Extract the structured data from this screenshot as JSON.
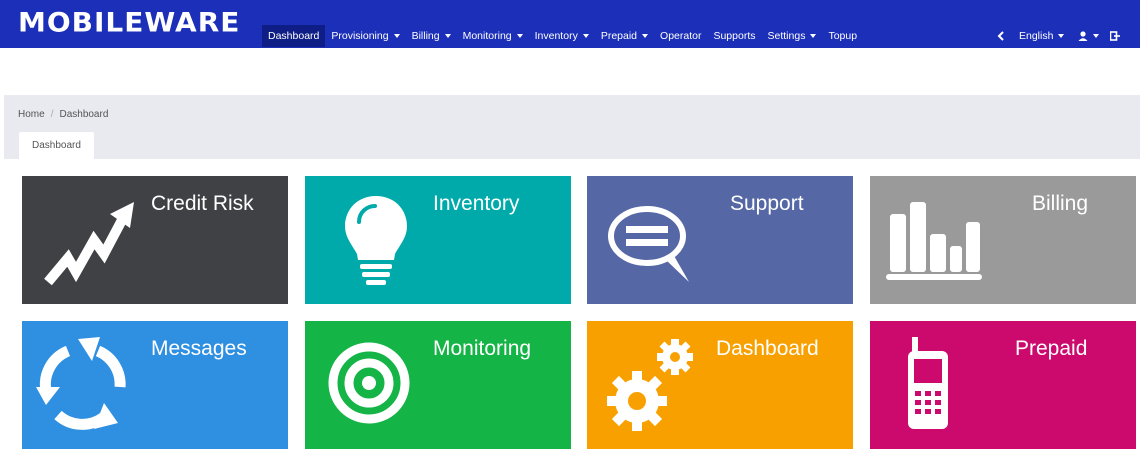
{
  "brand": {
    "name": "MOBILEWARE"
  },
  "nav": [
    {
      "label": "Dashboard",
      "active": true,
      "dropdown": false
    },
    {
      "label": "Provisioning",
      "dropdown": true
    },
    {
      "label": "Billing",
      "dropdown": true
    },
    {
      "label": "Monitoring",
      "dropdown": true
    },
    {
      "label": "Inventory",
      "dropdown": true
    },
    {
      "label": "Prepaid",
      "dropdown": true
    },
    {
      "label": "Operator",
      "dropdown": false
    },
    {
      "label": "Supports",
      "dropdown": false
    },
    {
      "label": "Settings",
      "dropdown": true
    },
    {
      "label": "Topup",
      "dropdown": false
    }
  ],
  "nav_right": {
    "collapse_icon": "chevron-left-icon",
    "language": "English",
    "user_icon": "user-icon",
    "logout_icon": "sign-out-icon"
  },
  "breadcrumb": {
    "home": "Home",
    "current": "Dashboard"
  },
  "tab": {
    "label": "Dashboard"
  },
  "tiles": [
    {
      "title": "Credit Risk",
      "icon": "rising-chart-arrow-icon",
      "color": "#3f4145"
    },
    {
      "title": "Inventory",
      "icon": "lightbulb-icon",
      "color": "#00aaaa"
    },
    {
      "title": "Support",
      "icon": "speech-bubble-icon",
      "color": "#5568a5"
    },
    {
      "title": "Billing",
      "icon": "bar-chart-icon",
      "color": "#9a9a9a"
    },
    {
      "title": "Messages",
      "icon": "refresh-cycle-icon",
      "color": "#2f8fe0"
    },
    {
      "title": "Monitoring",
      "icon": "target-icon",
      "color": "#14b446"
    },
    {
      "title": "Dashboard",
      "icon": "gears-icon",
      "color": "#f7a000"
    },
    {
      "title": "Prepaid",
      "icon": "mobile-phone-icon",
      "color": "#cc0a6e"
    }
  ]
}
